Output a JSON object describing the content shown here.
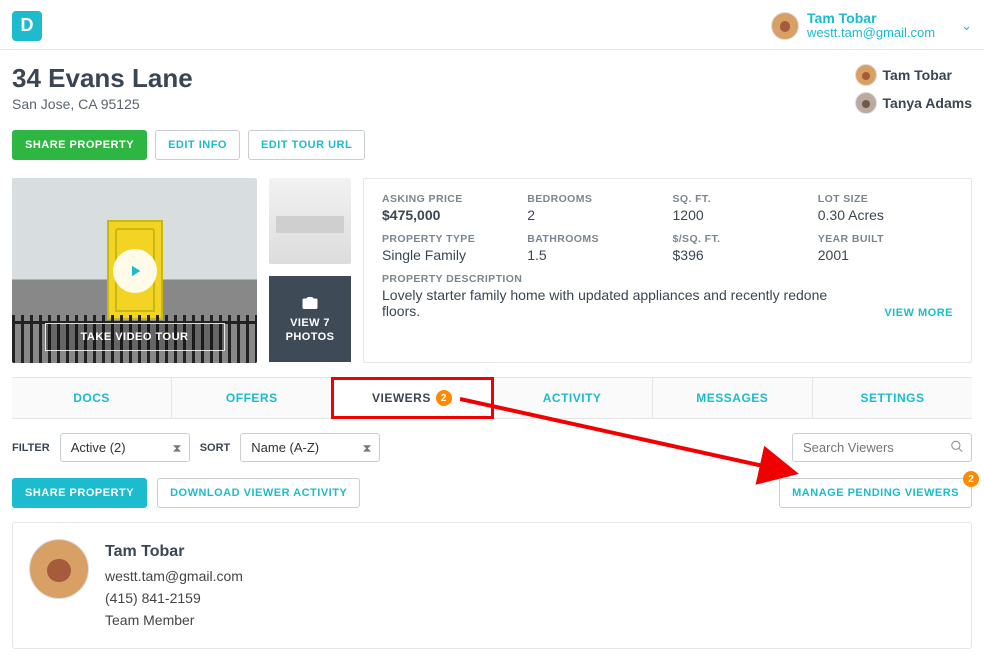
{
  "logo_letter": "D",
  "user": {
    "name": "Tam Tobar",
    "email": "westt.tam@gmail.com"
  },
  "property": {
    "title": "34 Evans Lane",
    "subtitle": "San Jose, CA 95125",
    "agents": [
      "Tam Tobar",
      "Tanya Adams"
    ]
  },
  "buttons": {
    "share": "Share Property",
    "edit_info": "Edit Info",
    "edit_tour": "Edit Tour URL",
    "video_tour": "TAKE VIDEO TOUR",
    "view_photos_line1": "VIEW 7",
    "view_photos_line2": "PHOTOS"
  },
  "details": {
    "asking_price": {
      "label": "ASKING PRICE",
      "value": "$475,000"
    },
    "bedrooms": {
      "label": "BEDROOMS",
      "value": "2"
    },
    "sqft": {
      "label": "SQ. FT.",
      "value": "1200"
    },
    "lot": {
      "label": "LOT SIZE",
      "value": "0.30 Acres"
    },
    "ptype": {
      "label": "PROPERTY TYPE",
      "value": "Single Family"
    },
    "baths": {
      "label": "BATHROOMS",
      "value": "1.5"
    },
    "per_sqft": {
      "label": "$/SQ. FT.",
      "value": "$396"
    },
    "year": {
      "label": "YEAR BUILT",
      "value": "2001"
    },
    "desc_label": "PROPERTY DESCRIPTION",
    "desc": "Lovely starter family home with updated appliances and recently redone floors.",
    "view_more": "VIEW MORE"
  },
  "tabs": {
    "docs": "Docs",
    "offers": "Offers",
    "viewers": "Viewers",
    "activity": "Activity",
    "messages": "Messages",
    "settings": "Settings",
    "viewers_badge": "2"
  },
  "controls": {
    "filter_label": "FILTER",
    "filter_value": "Active (2)",
    "sort_label": "SORT",
    "sort_value": "Name (A-Z)",
    "search_placeholder": "Search Viewers"
  },
  "actions": {
    "share": "Share Property",
    "download": "Download Viewer Activity",
    "manage": "Manage Pending Viewers",
    "manage_badge": "2"
  },
  "viewer": {
    "name": "Tam Tobar",
    "email": "westt.tam@gmail.com",
    "phone": "(415) 841-2159",
    "role": "Team Member"
  }
}
